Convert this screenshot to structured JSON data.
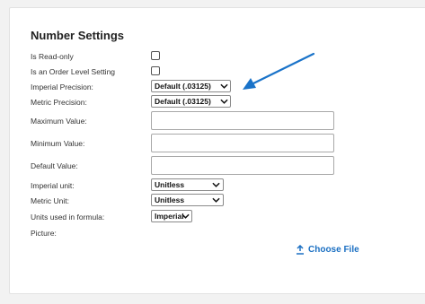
{
  "section_title": "Number Settings",
  "fields": {
    "read_only_label": "Is Read-only",
    "order_level_label": "Is an Order Level Setting",
    "imperial_precision_label": "Imperial Precision:",
    "imperial_precision_value": "Default (.03125)",
    "metric_precision_label": "Metric Precision:",
    "metric_precision_value": "Default (.03125)",
    "max_value_label": "Maximum Value:",
    "min_value_label": "Minimum Value:",
    "default_value_label": "Default Value:",
    "imperial_unit_label": "Imperial unit:",
    "imperial_unit_value": "Unitless",
    "metric_unit_label": "Metric Unit:",
    "metric_unit_value": "Unitless",
    "units_formula_label": "Units used in formula:",
    "units_formula_value": "Imperial",
    "picture_label": "Picture:",
    "choose_file_label": "Choose File"
  },
  "colors": {
    "accent": "#1a6fc2",
    "arrow": "#1a73c9"
  },
  "icons": [
    "chevron-down-icon",
    "upload-icon",
    "annotation-arrow"
  ]
}
